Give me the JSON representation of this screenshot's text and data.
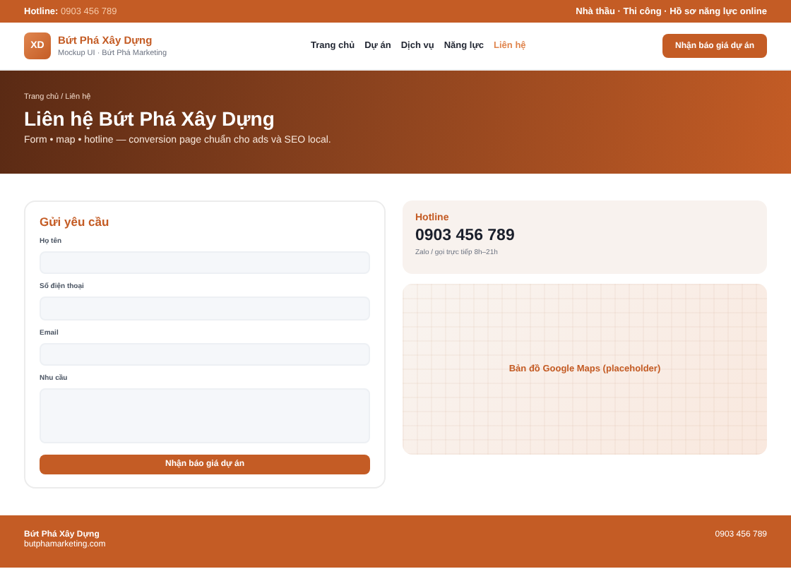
{
  "topbar": {
    "hotline_label": "Hotline:",
    "hotline_number": "0903 456 789",
    "tagline": "Nhà thầu · Thi công · Hồ sơ năng lực online"
  },
  "header": {
    "logo": "XD",
    "brand": "Bứt Phá Xây Dựng",
    "subtitle": "Mockup UI · Bứt Phá Marketing",
    "nav": [
      {
        "label": "Trang chủ",
        "selected": false
      },
      {
        "label": "Dự án",
        "selected": false
      },
      {
        "label": "Dịch vụ",
        "selected": false
      },
      {
        "label": "Năng lực",
        "selected": false
      },
      {
        "label": "Liên hệ",
        "selected": true
      }
    ],
    "cta": "Nhận báo giá dự án"
  },
  "hero": {
    "breadcrumb": "Trang chủ / Liên hệ",
    "title": "Liên hệ Bứt Phá Xây Dựng",
    "subtitle": "Form • map • hotline — conversion page chuẩn cho ads và SEO local."
  },
  "form": {
    "title": "Gửi yêu cầu",
    "fields": [
      {
        "label": "Họ tên",
        "kind": "input"
      },
      {
        "label": "Số điện thoại",
        "kind": "input"
      },
      {
        "label": "Email",
        "kind": "input"
      },
      {
        "label": "Nhu cầu",
        "kind": "textarea"
      }
    ],
    "submit": "Nhận báo giá dự án"
  },
  "hotline": {
    "label": "Hotline",
    "number": "0903 456 789",
    "note": "Zalo / gọi trực tiếp 8h–21h"
  },
  "map": {
    "label": "Bản đồ Google Maps (placeholder)"
  },
  "footer": {
    "brand": "Bứt Phá Xây Dựng",
    "site": "butphamarketing.com",
    "phone": "0903 456 789"
  }
}
